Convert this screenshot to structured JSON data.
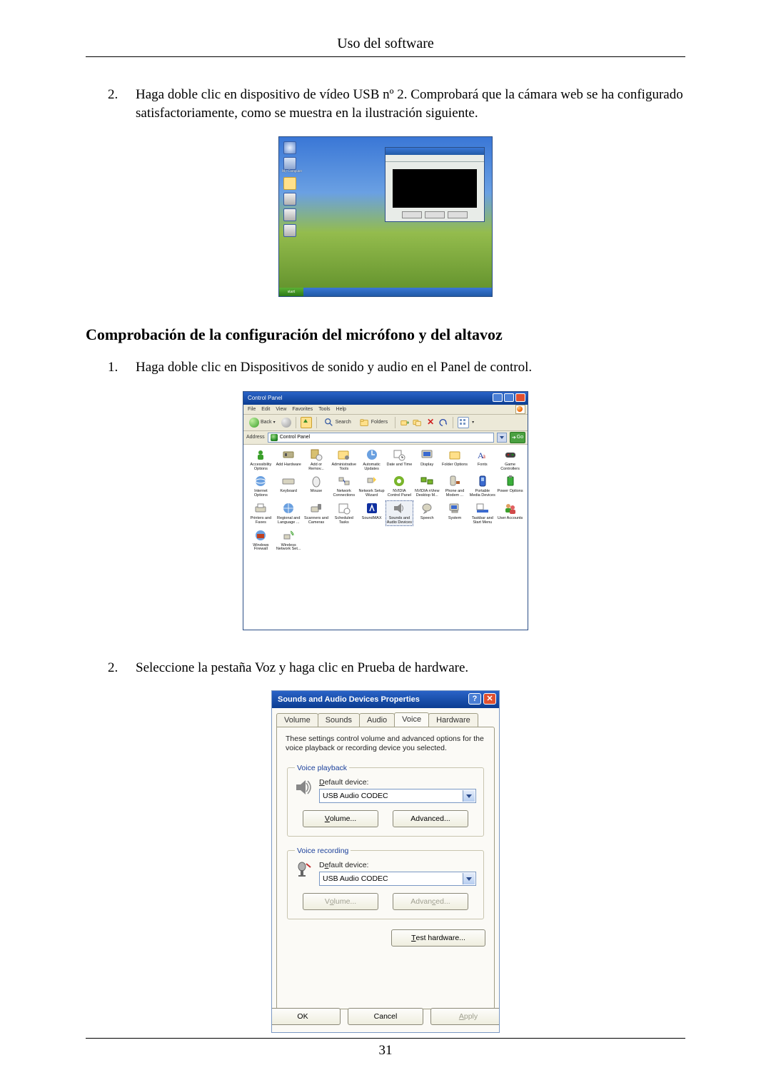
{
  "header": {
    "title": "Uso del software"
  },
  "page_number": "31",
  "intro_list": {
    "item2": "Haga doble clic en dispositivo de vídeo USB nº 2. Comprobará que la cámara web se ha configurado satisfactoriamente, como se muestra en la ilustración siguiente."
  },
  "section_heading": "Comprobación de la configuración del micrófono y del altavoz",
  "section_list": {
    "item1": "Haga doble clic en Dispositivos de sonido y audio en el Panel de control.",
    "item2": "Seleccione la pestaña Voz y haga clic en Prueba de hardware."
  },
  "desktop": {
    "my_computer": "My Computer",
    "start": "start"
  },
  "control_panel": {
    "title": "Control Panel",
    "menu": {
      "file": "File",
      "edit": "Edit",
      "view": "View",
      "favorites": "Favorites",
      "tools": "Tools",
      "help": "Help"
    },
    "toolbar": {
      "back": "Back",
      "search": "Search",
      "folders": "Folders"
    },
    "address_label": "Address",
    "address_value": "Control Panel",
    "go": "Go",
    "items_row1": [
      "Accessibility Options",
      "Add Hardware",
      "Add or Remov...",
      "Administrative Tools",
      "Automatic Updates",
      "Date and Time",
      "Display",
      "Folder Options",
      "Fonts"
    ],
    "items_row1_end": "Game Controllers",
    "items_row2": [
      "Internet Options",
      "Keyboard",
      "Mouse",
      "Network Connections",
      "Network Setup Wizard",
      "NVIDIA Control Panel",
      "NVIDIA nView Desktop M...",
      "Phone and Modem ...",
      "Portable Media Devices"
    ],
    "items_row2_end": "Power Options",
    "items_row3": [
      "Printers and Faxes",
      "Regional and Language ...",
      "Scanners and Cameras",
      "Scheduled Tasks",
      "SoundMAX",
      "Sounds and Audio Devices",
      "Speech",
      "System",
      "Taskbar and Start Menu"
    ],
    "items_row3_end": "User Accounts",
    "items_row4": [
      "Windows Firewall",
      "Wireless Network Set..."
    ]
  },
  "sounds_dialog": {
    "title": "Sounds and Audio Devices Properties",
    "tabs": {
      "volume": "Volume",
      "sounds": "Sounds",
      "audio": "Audio",
      "voice": "Voice",
      "hardware": "Hardware"
    },
    "desc": "These settings control volume and advanced options for the voice playback or recording device you selected.",
    "playback": {
      "legend": "Voice playback",
      "label": "Default device:",
      "label_u_before": "D",
      "label_after": "efault device:",
      "value": "USB Audio CODEC",
      "volume_u": "V",
      "volume_rest": "olume...",
      "advanced": "Advanced..."
    },
    "recording": {
      "legend": "Voice recording",
      "label_before": "D",
      "label_u": "e",
      "label_after": "fault device:",
      "value": "USB Audio CODEC",
      "volume_before": "V",
      "volume_u": "o",
      "volume_after": "lume...",
      "advanced_before": "Advan",
      "advanced_u": "c",
      "advanced_after": "ed..."
    },
    "test_u": "T",
    "test_rest": "est hardware...",
    "ok": "OK",
    "cancel": "Cancel",
    "apply_u": "A",
    "apply_rest": "pply"
  }
}
